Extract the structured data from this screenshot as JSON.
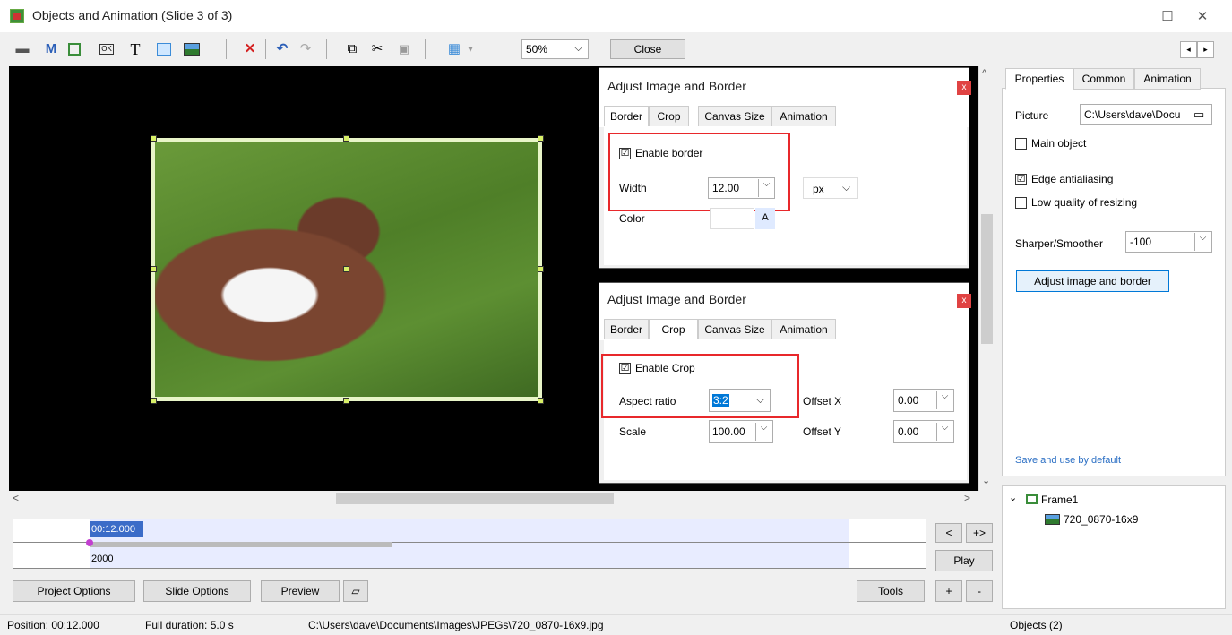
{
  "window": {
    "title": "Objects and Animation  (Slide 3 of 3)",
    "controls": {
      "minimize": "—",
      "maximize": "☐",
      "close": "✕"
    }
  },
  "toolbar": {
    "icons": [
      "camera-icon",
      "mask-icon",
      "frame-icon",
      "button-icon",
      "text-icon",
      "rectangle-icon",
      "image-icon",
      "delete-icon",
      "undo-icon",
      "redo-icon",
      "copy-icon",
      "cut-icon",
      "paste-icon",
      "grid-icon"
    ],
    "glyphs": {
      "m": "M",
      "t": "T",
      "ok": "OK",
      "delete": "✕",
      "undo": "↶",
      "redo": "↷",
      "copy": "⧉",
      "cut": "✂",
      "paste": "📋",
      "grid": "▦",
      "grid_arrow": "▾",
      "nav_left": "◂",
      "nav_right": "▸"
    },
    "zoom_value": "50%",
    "zoom_arrow": "⌵",
    "close_label": "Close"
  },
  "dialog_border": {
    "title": "Adjust Image and Border",
    "close": "x",
    "tabs": [
      "Border",
      "Crop",
      "Canvas Size",
      "Animation"
    ],
    "active_tab": "Border",
    "enable_label": "Enable border",
    "enable_checked": "☑",
    "width_label": "Width",
    "width_value": "12.00",
    "unit_value": "px",
    "dropdown_arrow": "⌵",
    "color_label": "Color",
    "color_button": "A"
  },
  "dialog_crop": {
    "title": "Adjust Image and Border",
    "close": "x",
    "tabs": [
      "Border",
      "Crop",
      "Canvas Size",
      "Animation"
    ],
    "active_tab": "Crop",
    "enable_label": "Enable Crop",
    "enable_checked": "☑",
    "aspect_label": "Aspect ratio",
    "aspect_value": "3:2",
    "offset_x_label": "Offset X",
    "offset_x_value": "0.00",
    "scale_label": "Scale",
    "scale_value": "100.00",
    "offset_y_label": "Offset Y",
    "offset_y_value": "0.00",
    "dropdown_arrow": "⌵"
  },
  "right_panel": {
    "tabs": [
      "Properties",
      "Common",
      "Animation"
    ],
    "active_tab": "Properties",
    "picture_label": "Picture",
    "picture_value": "C:\\Users\\dave\\Docu",
    "main_object_label": "Main object",
    "edge_label": "Edge antialiasing",
    "low_quality_label": "Low quality of resizing",
    "sharper_label": "Sharper/Smoother",
    "sharper_value": "-100",
    "adjust_button": "Adjust image and border",
    "save_default": "Save and use by default",
    "checked_glyph": "☑",
    "dropdown_arrow": "⌵"
  },
  "object_tree": {
    "root_expander": "⌄",
    "root": "Frame1",
    "child": "720_0870-16x9"
  },
  "scroll": {
    "up": "^",
    "down": "⌄",
    "left": "<",
    "right": ">"
  },
  "timeline": {
    "time_label": "00:12.000",
    "value_label": "2000",
    "prev_label": "<",
    "next_label": "+>",
    "play_label": "Play",
    "plus_label": "+",
    "minus_label": "-"
  },
  "bottom_buttons": {
    "project_options": "Project Options",
    "slide_options": "Slide Options",
    "preview": "Preview",
    "tools": "Tools"
  },
  "status_bar": {
    "position": "Position: 00:12.000",
    "duration": "Full duration: 5.0 s",
    "path": "C:\\Users\\dave\\Documents\\Images\\JPEGs\\720_0870-16x9.jpg",
    "objects": "Objects (2)"
  },
  "colors": {
    "highlight_red": "#e8282b",
    "accent_blue": "#0078d7",
    "timeline_fill": "#e8ecff"
  }
}
